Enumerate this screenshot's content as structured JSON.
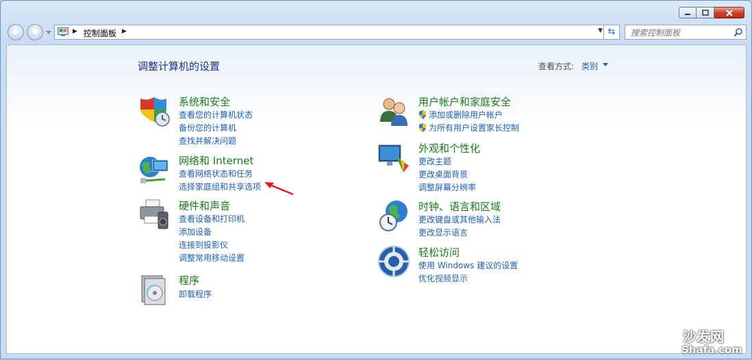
{
  "address_bar": {
    "breadcrumb": "控制面板",
    "search_placeholder": "搜索控制面板"
  },
  "header": {
    "title": "调整计算机的设置",
    "view_by_label": "查看方式:",
    "view_by_value": "类别"
  },
  "categories": [
    {
      "title": "系统和安全",
      "icon": "shield-icon",
      "links": [
        "查看您的计算机状态",
        "备份您的计算机",
        "查找并解决问题"
      ]
    },
    {
      "title": "网络和 Internet",
      "icon": "network-icon",
      "links": [
        "查看网络状态和任务",
        "选择家庭组和共享选项"
      ]
    },
    {
      "title": "硬件和声音",
      "icon": "printer-icon",
      "links": [
        "查看设备和打印机",
        "添加设备",
        "连接到投影仪",
        "调整常用移动设置"
      ]
    },
    {
      "title": "程序",
      "icon": "programs-icon",
      "links": [
        "卸载程序"
      ]
    },
    {
      "title": "用户帐户和家庭安全",
      "icon": "users-icon",
      "links": [
        "添加或删除用户帐户",
        "为所有用户设置家长控制"
      ]
    },
    {
      "title": "外观和个性化",
      "icon": "monitor-palette-icon",
      "links": [
        "更改主题",
        "更改桌面背景",
        "调整屏幕分辨率"
      ]
    },
    {
      "title": "时钟、语言和区域",
      "icon": "globe-clock-icon",
      "links": [
        "更改键盘或其他输入法",
        "更改显示语言"
      ]
    },
    {
      "title": "轻松访问",
      "icon": "ease-of-access-icon",
      "links": [
        "使用 Windows 建议的设置",
        "优化视频显示"
      ]
    }
  ],
  "watermark": {
    "name_cn": "沙发网",
    "name_en": "Shafa.com"
  },
  "colors": {
    "category_title": "#1b7a1b",
    "link": "#1d5fb4",
    "page_title": "#1e3287",
    "annotation_arrow": "#e8161b"
  }
}
